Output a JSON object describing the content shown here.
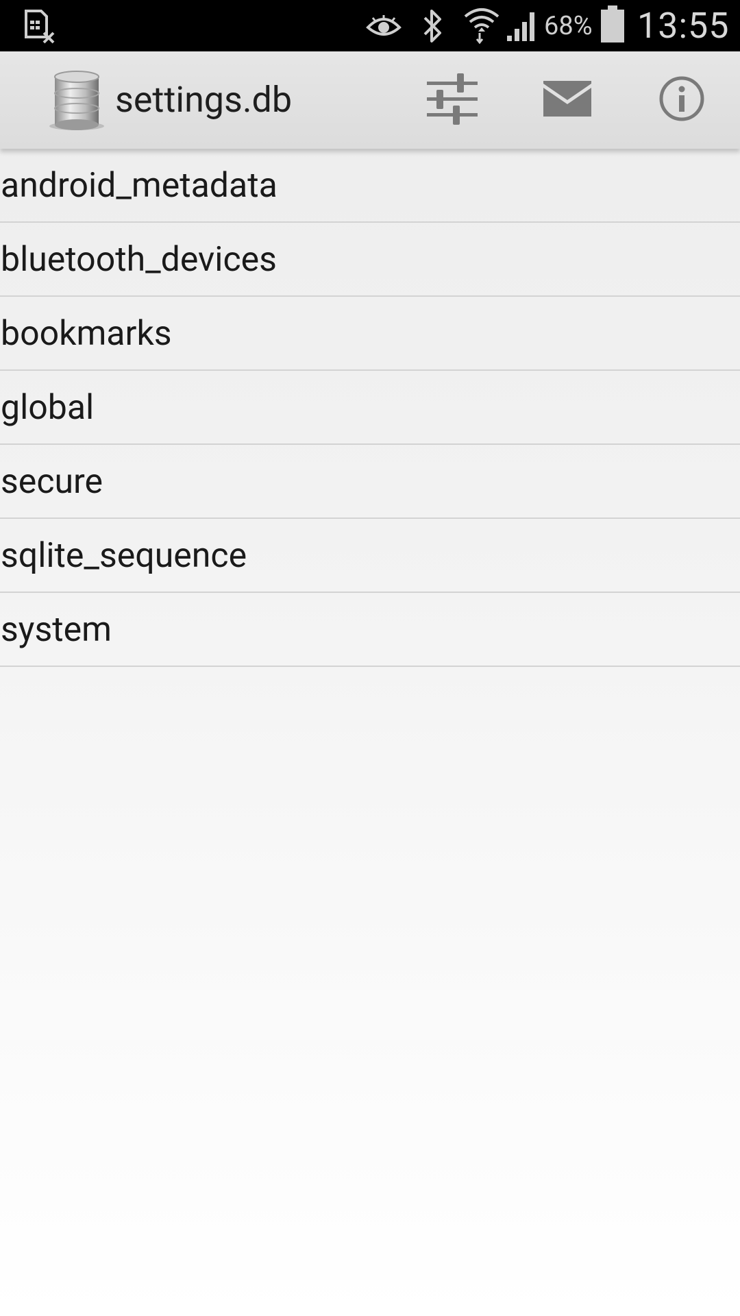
{
  "status_bar": {
    "battery_percent": "68%",
    "time": "13:55",
    "icons": [
      "sim-card-x-icon",
      "eye-icon",
      "bluetooth-icon",
      "wifi-icon",
      "signal-icon",
      "battery-icon"
    ]
  },
  "action_bar": {
    "title": "settings.db",
    "icons": [
      "database-icon",
      "sliders-icon",
      "mail-icon",
      "info-icon"
    ]
  },
  "tables": [
    {
      "label": "android_metadata"
    },
    {
      "label": "bluetooth_devices"
    },
    {
      "label": "bookmarks"
    },
    {
      "label": "global"
    },
    {
      "label": "secure"
    },
    {
      "label": "sqlite_sequence"
    },
    {
      "label": "system"
    }
  ],
  "colors": {
    "status_bar_bg": "#000000",
    "action_bar_bg": "#e0e0e0",
    "icon_gray": "#7a7a7a",
    "divider": "#d3d3d3",
    "text": "#1a1a1a"
  }
}
